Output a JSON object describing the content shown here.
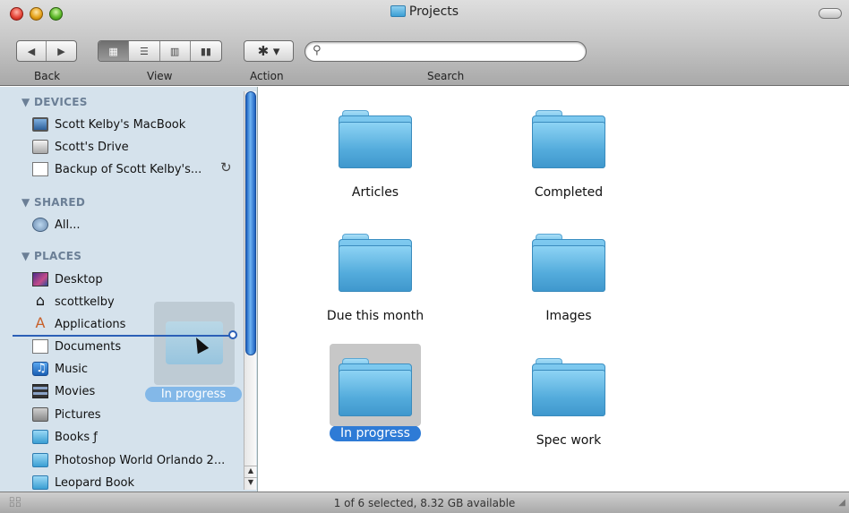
{
  "window": {
    "title": "Projects"
  },
  "toolbar": {
    "back_label": "Back",
    "view_label": "View",
    "action_label": "Action",
    "search_label": "Search",
    "search_value": "",
    "back_glyph": "◀",
    "forward_glyph": "▶",
    "view_icons": [
      "icon-view-icon",
      "list-view-icon",
      "column-view-icon",
      "coverflow-view-icon"
    ],
    "action_glyph": "✱ ▾",
    "search_glyph": "🔍"
  },
  "sidebar": {
    "sections": [
      {
        "title": "▼ DEVICES"
      },
      {
        "title": "▼ SHARED"
      },
      {
        "title": "▼ PLACES"
      }
    ],
    "devices": [
      {
        "label": "Scott Kelby's MacBook",
        "icon": "laptop-icon"
      },
      {
        "label": "Scott's Drive",
        "icon": "hard-drive-icon"
      },
      {
        "label": "Backup of Scott Kelby's...",
        "icon": "disk-image-icon"
      }
    ],
    "shared": [
      {
        "label": "All...",
        "icon": "network-icon"
      }
    ],
    "places": [
      {
        "label": "Desktop",
        "icon": "desktop-icon"
      },
      {
        "label": "scottkelby",
        "icon": "home-icon"
      },
      {
        "label": "Applications",
        "icon": "applications-icon"
      },
      {
        "label": "Documents",
        "icon": "documents-icon"
      },
      {
        "label": "Music",
        "icon": "music-icon"
      },
      {
        "label": "Movies",
        "icon": "movies-icon"
      },
      {
        "label": "Pictures",
        "icon": "pictures-icon"
      },
      {
        "label": "Books ƒ",
        "icon": "folder-icon"
      },
      {
        "label": "Photoshop World Orlando 2...",
        "icon": "folder-icon"
      },
      {
        "label": "Leopard Book",
        "icon": "folder-icon"
      }
    ],
    "drag_ghost_label": "In progress"
  },
  "content": {
    "items": [
      {
        "label": "Articles",
        "selected": false
      },
      {
        "label": "Completed",
        "selected": false
      },
      {
        "label": "Due this month",
        "selected": false
      },
      {
        "label": "Images",
        "selected": false
      },
      {
        "label": "In progress",
        "selected": true
      },
      {
        "label": "Spec work",
        "selected": false
      }
    ]
  },
  "status_bar": {
    "text": "1 of 6 selected, 8.32 GB available"
  },
  "colors": {
    "selection": "#2e7bd6",
    "sidebar_bg": "#d5e2ec",
    "folder": "#54acdc"
  }
}
